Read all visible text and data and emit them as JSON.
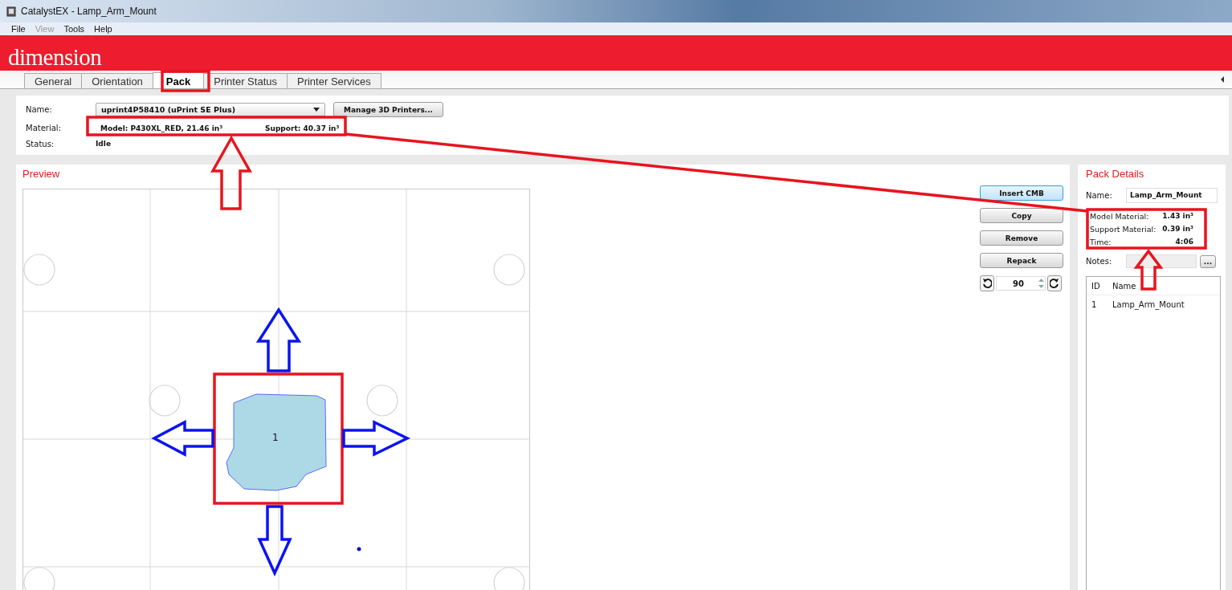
{
  "window": {
    "title": "CatalystEX - Lamp_Arm_Mount"
  },
  "menu": [
    {
      "label": "File",
      "disabled": false
    },
    {
      "label": "View",
      "disabled": true
    },
    {
      "label": "Tools",
      "disabled": false
    },
    {
      "label": "Help",
      "disabled": false
    }
  ],
  "brand": {
    "logo": "dimension"
  },
  "tabs": [
    {
      "label": "General",
      "selected": false
    },
    {
      "label": "Orientation",
      "selected": false
    },
    {
      "label": "Pack",
      "selected": true
    },
    {
      "label": "Printer Status",
      "selected": false
    },
    {
      "label": "Printer Services",
      "selected": false
    }
  ],
  "printer": {
    "name_label": "Name:",
    "name_value": "uprint4P58410  (uPrint SE Plus)",
    "manage_button": "Manage 3D Printers...",
    "material_label": "Material:",
    "model_material": "Model: P430XL_RED, 21.46 in³",
    "support_material": "Support: 40.37 in³",
    "status_label": "Status:",
    "status_value": "Idle"
  },
  "preview": {
    "title": "Preview",
    "part_label": "1"
  },
  "actions": [
    {
      "label": "Insert CMB",
      "selected": true
    },
    {
      "label": "Copy",
      "selected": false
    },
    {
      "label": "Remove",
      "selected": false
    },
    {
      "label": "Repack",
      "selected": false
    }
  ],
  "rotation": {
    "value": "90"
  },
  "pack_details": {
    "title": "Pack Details",
    "name_label": "Name:",
    "name_value": "Lamp_Arm_Mount",
    "stats": [
      {
        "label": "Model Material:",
        "value": "1.43 in³"
      },
      {
        "label": "Support Material:",
        "value": "0.39 in³"
      },
      {
        "label": "Time:",
        "value": "4:06"
      }
    ],
    "notes_label": "Notes:",
    "notes_button": "...",
    "table": {
      "columns": [
        "ID",
        "Name"
      ],
      "rows": [
        [
          "1",
          "Lamp_Arm_Mount"
        ]
      ]
    }
  }
}
